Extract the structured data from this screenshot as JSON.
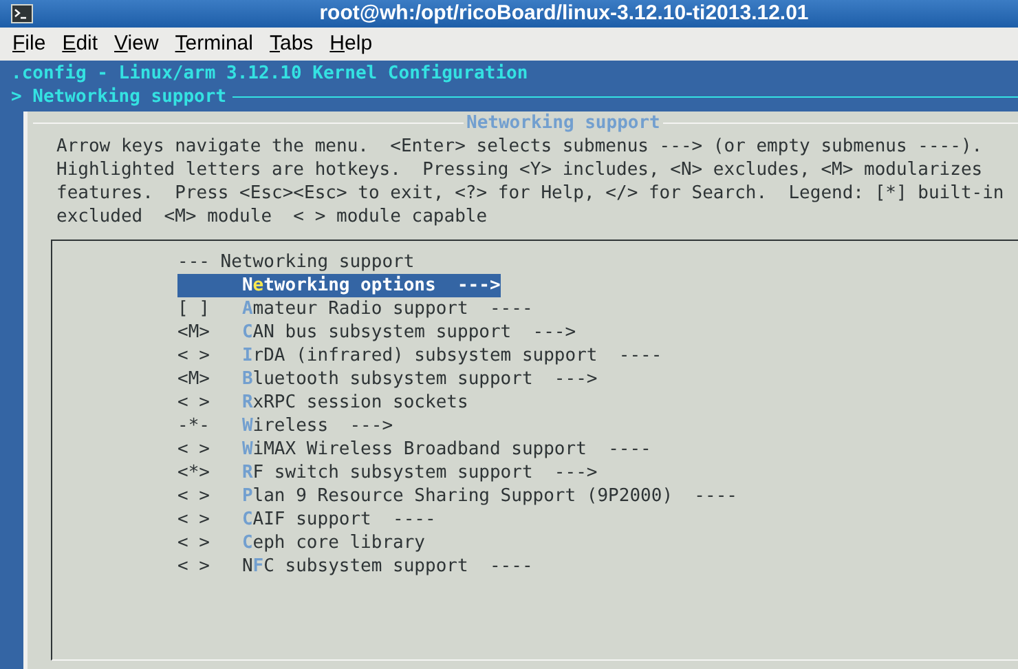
{
  "window": {
    "title": "root@wh:/opt/ricoBoard/linux-3.12.10-ti2013.12.01"
  },
  "menu": [
    {
      "label": "File"
    },
    {
      "label": "Edit"
    },
    {
      "label": "View"
    },
    {
      "label": "Terminal"
    },
    {
      "label": "Tabs"
    },
    {
      "label": "Help"
    }
  ],
  "terminal": {
    "config_title": ".config - Linux/arm 3.12.10 Kernel Configuration",
    "breadcrumb": "> Networking support",
    "dialog": {
      "title": "Networking support",
      "help_lines": [
        "Arrow keys navigate the menu.  <Enter> selects submenus ---> (or empty submenus ----).",
        "Highlighted letters are hotkeys.  Pressing <Y> includes, <N> excludes, <M> modularizes",
        "features.  Press <Esc><Esc> to exit, <?> for Help, </> for Search.  Legend: [*] built-in",
        "excluded  <M> module  < > module capable"
      ],
      "items": [
        {
          "kind": "header",
          "text": "--- Networking support"
        },
        {
          "kind": "option",
          "before": "N",
          "hotkey": "e",
          "after": "tworking options",
          "suffix": "--->",
          "selected": true
        },
        {
          "kind": "option",
          "state": "[ ]",
          "hotkey": "A",
          "after": "mateur Radio support",
          "suffix": "----",
          "selected": false
        },
        {
          "kind": "option",
          "state": "<M>",
          "hotkey": "C",
          "after": "AN bus subsystem support",
          "suffix": "--->",
          "selected": false
        },
        {
          "kind": "option",
          "state": "< >",
          "hotkey": "I",
          "after": "rDA (infrared) subsystem support",
          "suffix": "----",
          "selected": false
        },
        {
          "kind": "option",
          "state": "<M>",
          "hotkey": "B",
          "after": "luetooth subsystem support",
          "suffix": "--->",
          "selected": false
        },
        {
          "kind": "option",
          "state": "< >",
          "hotkey": "R",
          "after": "xRPC session sockets",
          "selected": false
        },
        {
          "kind": "option",
          "state": "-*-",
          "hotkey": "W",
          "after": "ireless",
          "suffix": "--->",
          "selected": false
        },
        {
          "kind": "option",
          "state": "< >",
          "hotkey": "W",
          "after": "iMAX Wireless Broadband support",
          "suffix": "----",
          "selected": false
        },
        {
          "kind": "option",
          "state": "<*>",
          "hotkey": "R",
          "after": "F switch subsystem support",
          "suffix": "--->",
          "selected": false
        },
        {
          "kind": "option",
          "state": "< >",
          "hotkey": "P",
          "after": "lan 9 Resource Sharing Support (9P2000)",
          "suffix": "----",
          "selected": false
        },
        {
          "kind": "option",
          "state": "< >",
          "hotkey": "C",
          "after": "AIF support",
          "suffix": "----",
          "selected": false
        },
        {
          "kind": "option",
          "state": "< >",
          "hotkey": "C",
          "after": "eph core library",
          "selected": false
        },
        {
          "kind": "option",
          "state": "< >",
          "before": "N",
          "hotkey": "F",
          "after": "C subsystem support",
          "suffix": "----",
          "selected": false
        }
      ]
    }
  }
}
